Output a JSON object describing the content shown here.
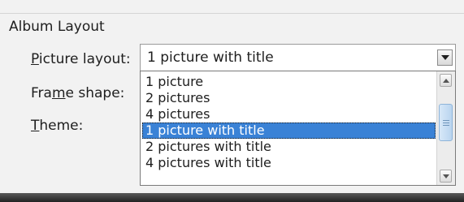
{
  "album_layout": {
    "title": "Album Layout",
    "picture_layout": {
      "label_before": "",
      "label_mnemonic": "P",
      "label_after": "icture layout:",
      "value": "1 picture with title",
      "options": [
        "1 picture",
        "2 pictures",
        "4 pictures",
        "1 picture with title",
        "2 pictures with title",
        "4 pictures with title"
      ],
      "selected_index": 3
    },
    "frame_shape": {
      "label_before": "Fra",
      "label_mnemonic": "m",
      "label_after": "e shape:"
    },
    "theme": {
      "label_before": "",
      "label_mnemonic": "T",
      "label_after": "heme:"
    }
  },
  "icons": {
    "dropdown_button": "chevron-down-icon",
    "scroll_up": "chevron-up-icon",
    "scroll_down": "chevron-down-icon",
    "scroll_grip": "grip-icon"
  },
  "colors": {
    "selection": "#3a82d6",
    "scroll_thumb": "#c6ddf3"
  }
}
